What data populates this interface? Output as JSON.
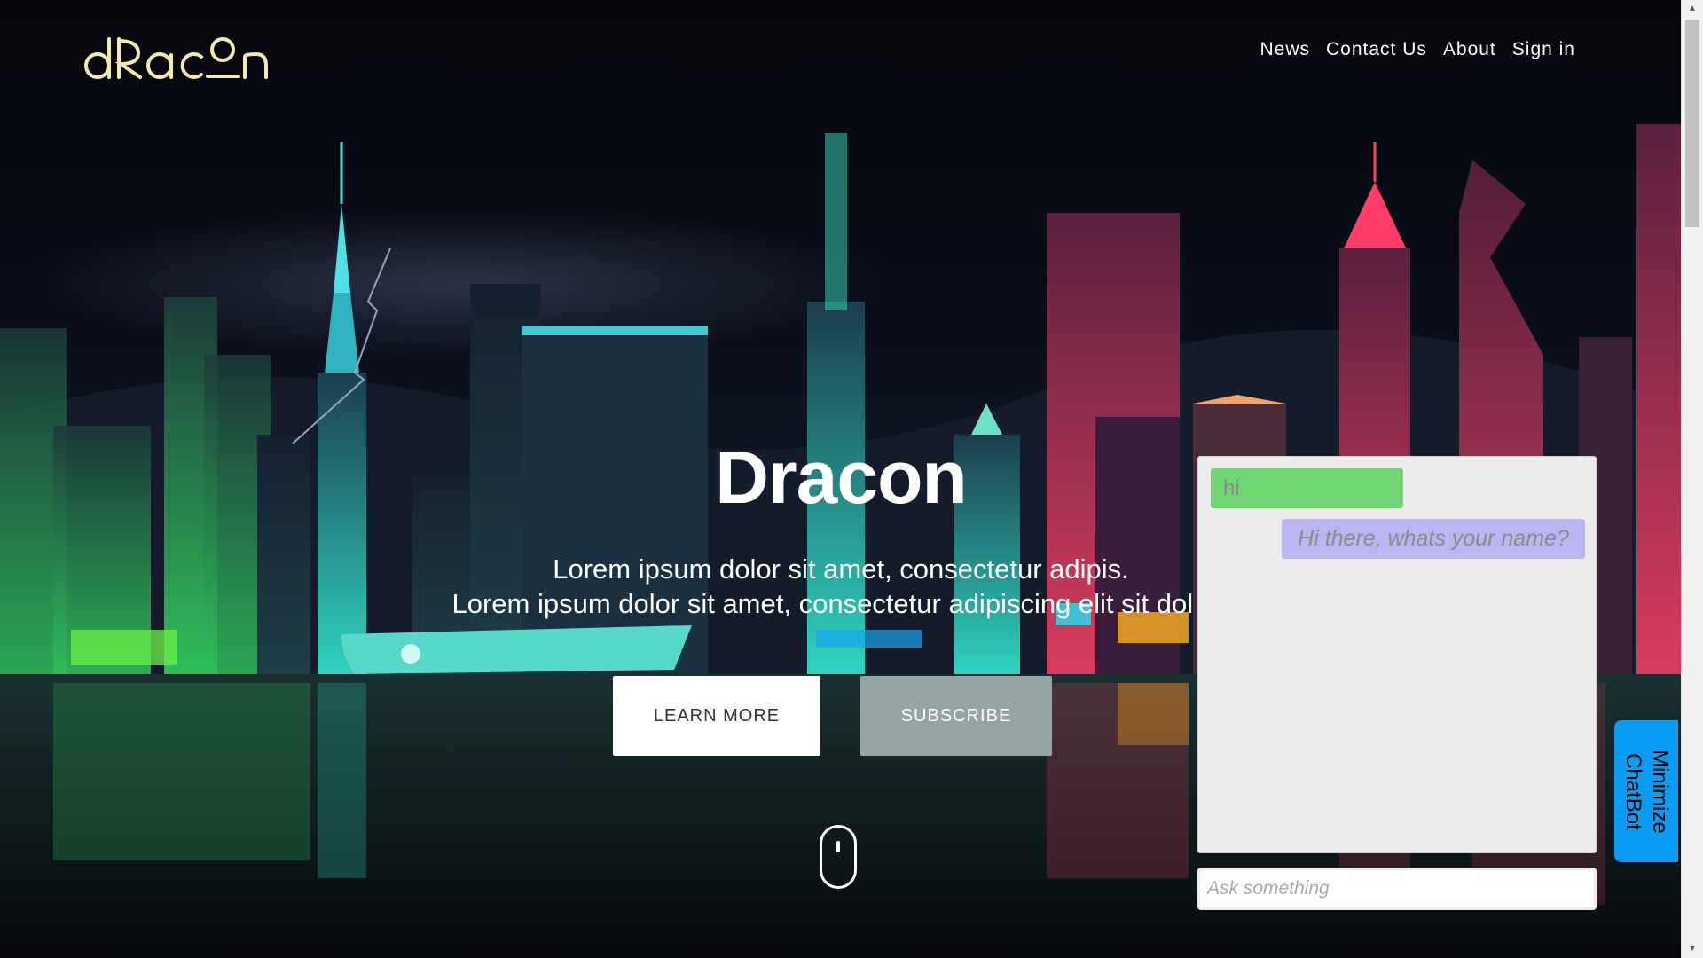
{
  "header": {
    "logo_text": "dRacon",
    "nav": [
      "News",
      "Contact Us",
      "About",
      "Sign in"
    ]
  },
  "hero": {
    "title": "Dracon",
    "subtitle_line1": "Lorem ipsum dolor sit amet, consectetur adipis.",
    "subtitle_line2": "Lorem ipsum dolor sit amet, consectetur adipiscing elit sit dol mi",
    "learn_more": "LEARN MORE",
    "subscribe": "SUBSCRIBE",
    "scroll_icon": "mouse-scroll-icon"
  },
  "chat": {
    "messages": [
      {
        "from": "user",
        "text": "hi"
      },
      {
        "from": "bot",
        "text": "Hi there, whats your name?"
      }
    ],
    "input_placeholder": "Ask something",
    "minimize_label": "Minimize ChatBot"
  },
  "colors": {
    "user_bubble": "#6fd673",
    "bot_bubble": "#b9b6f1",
    "minimize_button": "#0a9cf5",
    "subscribe_button": "#95a5a6",
    "logo": "#f2eab0"
  }
}
